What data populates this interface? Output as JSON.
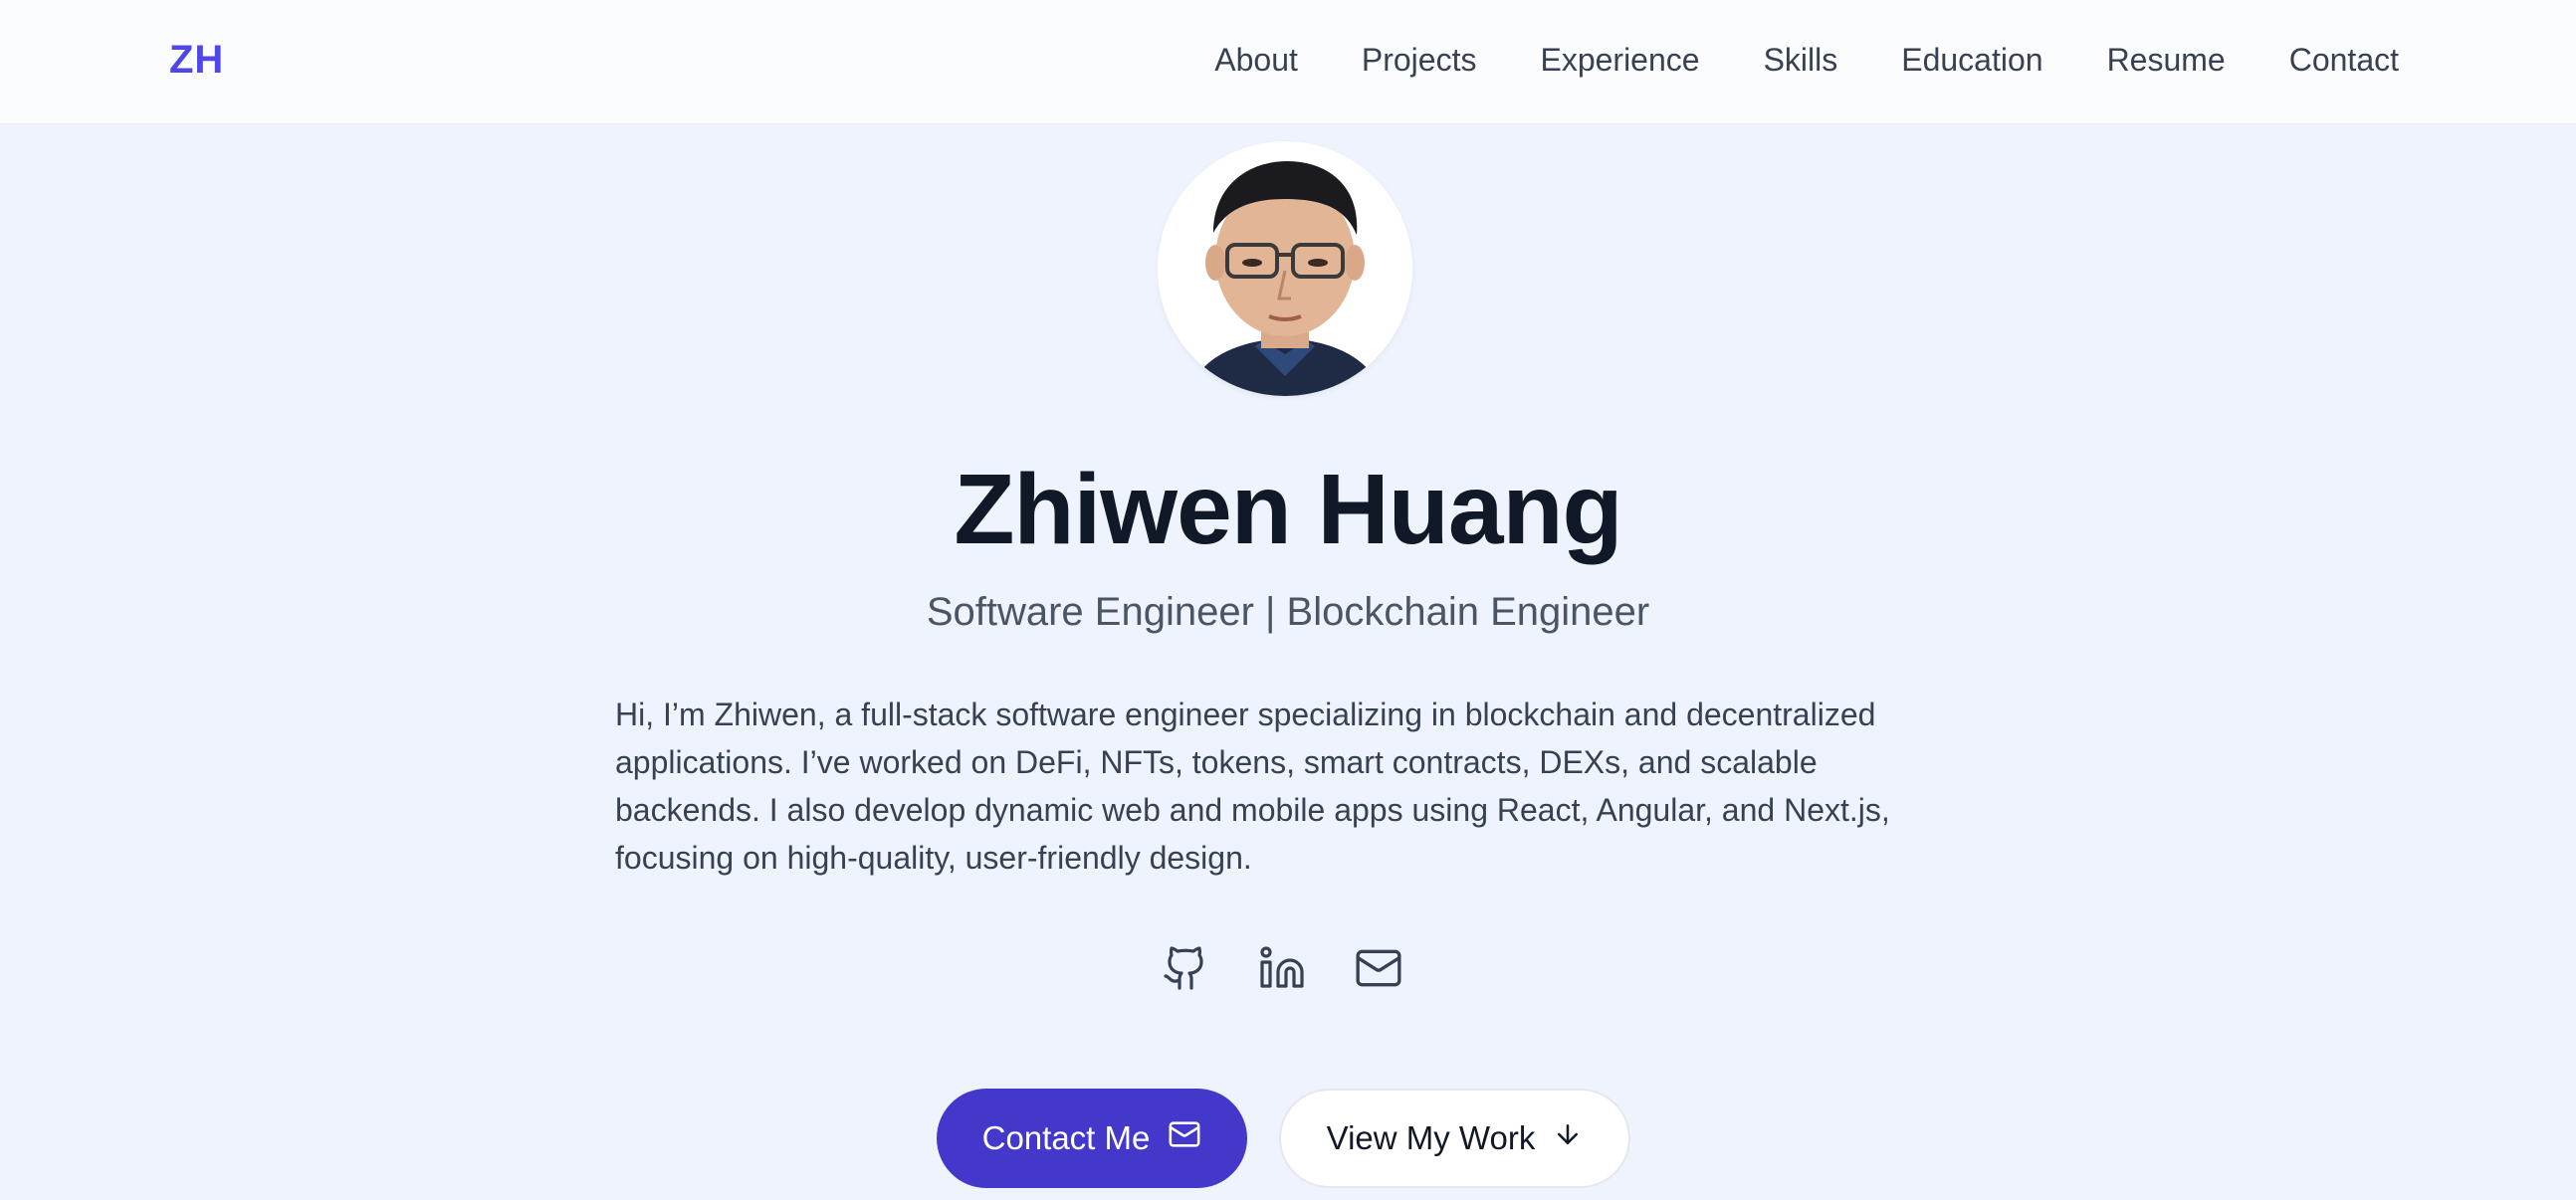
{
  "header": {
    "logo": "ZH",
    "nav": [
      "About",
      "Projects",
      "Experience",
      "Skills",
      "Education",
      "Resume",
      "Contact"
    ]
  },
  "hero": {
    "name": "Zhiwen Huang",
    "subtitle": "Software Engineer | Blockchain Engineer",
    "bio": "Hi, I’m Zhiwen, a full-stack software engineer specializing in blockchain and decentralized applications. I’ve worked on DeFi, NFTs, tokens, smart contracts, DEXs, and scalable backends. I also develop dynamic web and mobile apps using React, Angular, and Next.js, focusing on high-quality, user-friendly design.",
    "socials": [
      "github-icon",
      "linkedin-icon",
      "mail-icon"
    ],
    "buttons": {
      "contact_label": "Contact Me",
      "contact_icon": "mail-icon",
      "work_label": "View My Work",
      "work_icon": "arrow-down-icon"
    }
  },
  "colors": {
    "accent": "#4f46e5",
    "primary_button": "#4338ca",
    "background": "#eff3fd",
    "heading": "#111827",
    "body_text": "#374151"
  }
}
